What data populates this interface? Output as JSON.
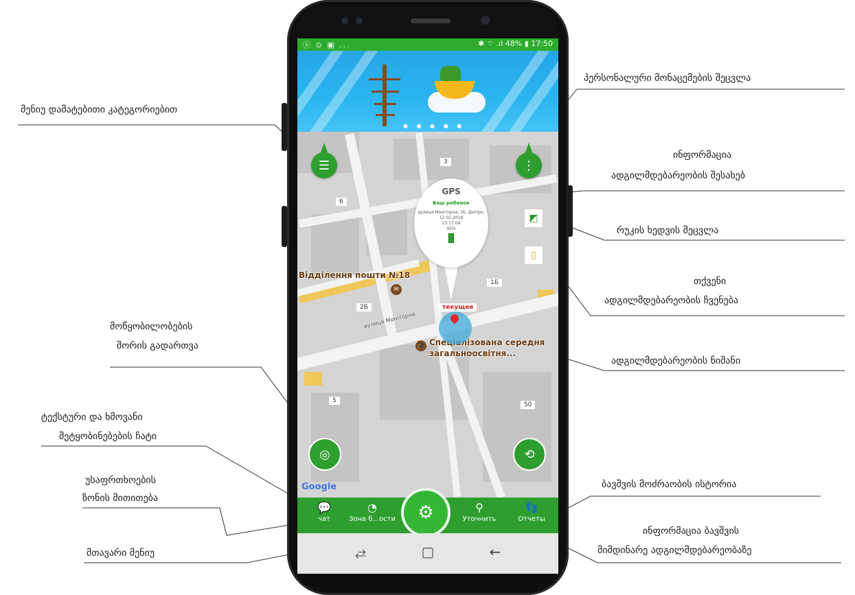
{
  "status_bar": {
    "left_icons": "ⓢ ⊙ ▣ ...",
    "right_text": "✱ ⌔ .ıl 48% ▮ 17:50"
  },
  "map": {
    "house_numbers": [
      "3",
      "6",
      "2Б",
      "1Б",
      "5",
      "50"
    ],
    "callout": {
      "title": "GPS",
      "subtitle": "Ваш ребенок",
      "address": "вулиця Моніторна, 1Б, Дніпро,",
      "date": "12.02.2018",
      "time": "13:17:04",
      "battery": "92%"
    },
    "street_label": "вулиця Моніторна",
    "place_post": "Відділення пошти №18",
    "place_school_line1": "Спеціалізована середня",
    "place_school_line2": "загальноосвітня...",
    "current_label": "текущее",
    "google_logo": "Google"
  },
  "bottom_nav": {
    "chat": "чат",
    "zone": "Зона б...ости",
    "refine": "Уточнить",
    "reports": "Отчеты"
  },
  "annotations": {
    "menu_categories": "მენიუ დამატებითი კატეგორიებით",
    "edit_personal": "პერსონალური მონაცემების შეცვლა",
    "location_info_1": "ინფორმაცია",
    "location_info_2": "ადგილმდებარეობის შესახებ",
    "map_view": "რუკის ხედვის შეცვლა",
    "your_location_1": "თქვენი",
    "your_location_2": "ადგილმდებარეობის ჩვენება",
    "switch_devices_1": "მოწყობილობების",
    "switch_devices_2": "შორის გადართვა",
    "location_marker": "ადგილმდებარეობის ნიშანი",
    "chat_1": "ტექსტური და ხმოვანი",
    "chat_2": "შეტყობინებების ჩატი",
    "safety_zone_1": "უსაფრთხოების",
    "safety_zone_2": "ზონის მითითება",
    "history": "ბავშვის მოძრაობის ისტორია",
    "main_menu": "მთავარი მენიუ",
    "child_location_1": "ინფორმაცია ბავშვის",
    "child_location_2": "მიმდინარე ადგილმდებარეობაზე"
  },
  "colors": {
    "accent_green": "#2e9e2e",
    "banner_blue": "#2ab6f0",
    "status_red": "#d32020"
  }
}
